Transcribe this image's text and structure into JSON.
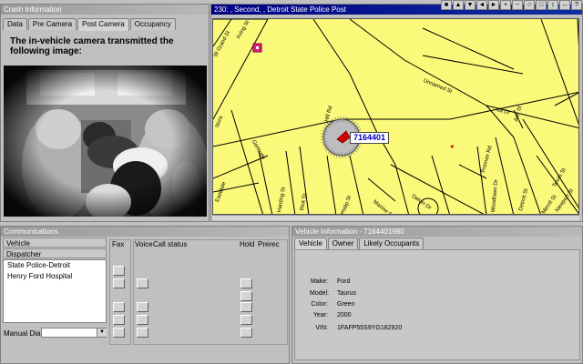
{
  "crash_panel": {
    "title": "Crash Information",
    "tabs": [
      "Data",
      "Pre Camera",
      "Post Camera",
      "Occupancy"
    ],
    "selected_tab": 2,
    "caption_line1": "The in-vehicle camera transmitted the",
    "caption_line2": "following image:"
  },
  "map_panel": {
    "title": "230: , Second, , Detroit State Police Post",
    "vehicle_label": "7164401",
    "streets": [
      "W Grand St",
      "Irving St",
      "Unnamed St",
      "Ash St",
      "da Dr",
      "Premier Rd",
      "Texas St",
      "Gertrude",
      "Nora",
      "Hill Rd",
      "Rick St",
      "Harding St",
      "Philip St",
      "Delvin Dr",
      "Woodlawn Dr",
      "Detroit St",
      "Merrill St",
      "Newport St",
      "Maxine Dr",
      "Eastdale"
    ]
  },
  "comm_panel": {
    "title": "Communications",
    "vehicle_header": "Vehicle",
    "dispatcher_header": "Dispatcher",
    "contacts": [
      "State Police-Detroit",
      "Henry Ford Hospital"
    ],
    "fax_label": "Fax",
    "voice_label": "Voice",
    "call_status_label": "Call status",
    "hold_label": "Hold",
    "prerec_label": "Prerec",
    "manual_dial_label": "Manual Dial:"
  },
  "vehicle_panel": {
    "title": "Vehicle Information - 7164401980",
    "tabs": [
      "Vehicle",
      "Owner",
      "Likely Occupants"
    ],
    "selected_tab": 0,
    "fields": [
      {
        "label": "Make:",
        "value": "Ford"
      },
      {
        "label": "Model:",
        "value": "Taurus"
      },
      {
        "label": "Color:",
        "value": "Green"
      },
      {
        "label": "Year:",
        "value": "2000"
      },
      {
        "label": "VIN:",
        "value": "1FAFP55S9YG182920"
      }
    ]
  }
}
